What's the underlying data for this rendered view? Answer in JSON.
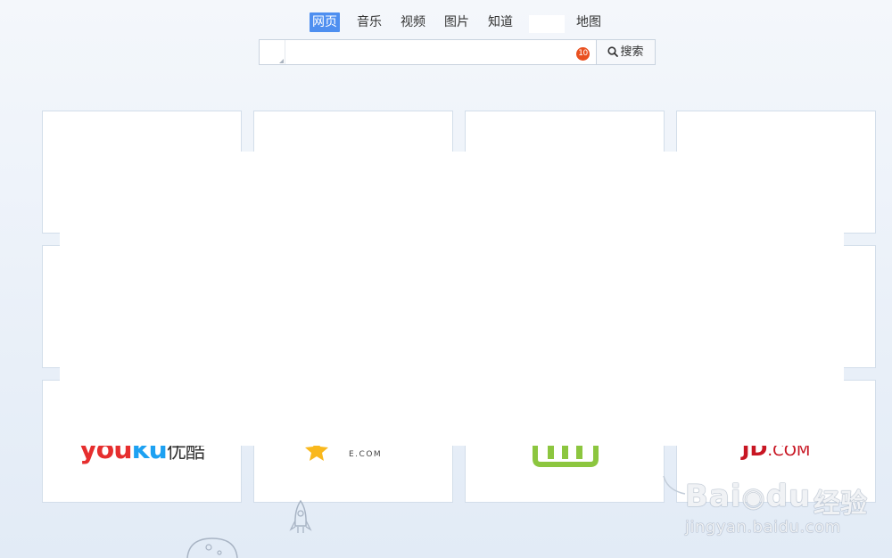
{
  "nav": {
    "items": [
      {
        "label": "网页",
        "active": true
      },
      {
        "label": "音乐",
        "active": false
      },
      {
        "label": "视频",
        "active": false
      },
      {
        "label": "图片",
        "active": false
      },
      {
        "label": "知道",
        "active": false
      },
      {
        "label": "地图",
        "active": false
      }
    ]
  },
  "search": {
    "value": "",
    "placeholder": "",
    "badge_count": "10",
    "button_label": "搜索",
    "button_icon": "magnifier-icon"
  },
  "tiles": {
    "row3": {
      "youku": {
        "text_1": "you",
        "text_2": "ku",
        "text_3": "优酷"
      },
      "star": {
        "domain": "E.COM",
        "icon": "star-icon"
      },
      "iqiyi": {
        "icon": "iqiyi-logo"
      },
      "jd": {
        "text_1": "JD",
        "text_2": ".COM"
      }
    }
  },
  "watermark": {
    "brand": "Bai",
    "brand_2": "du",
    "product": "经验",
    "url": "jingyan.baidu.com"
  },
  "colors": {
    "accent": "#4e8ff0",
    "badge": "#e9501f",
    "youku_red": "#e62e2e",
    "youku_blue": "#1da1f2",
    "iqiyi_green": "#8cc63f",
    "jd_red": "#c81623",
    "star_yellow": "#f9b81d"
  }
}
